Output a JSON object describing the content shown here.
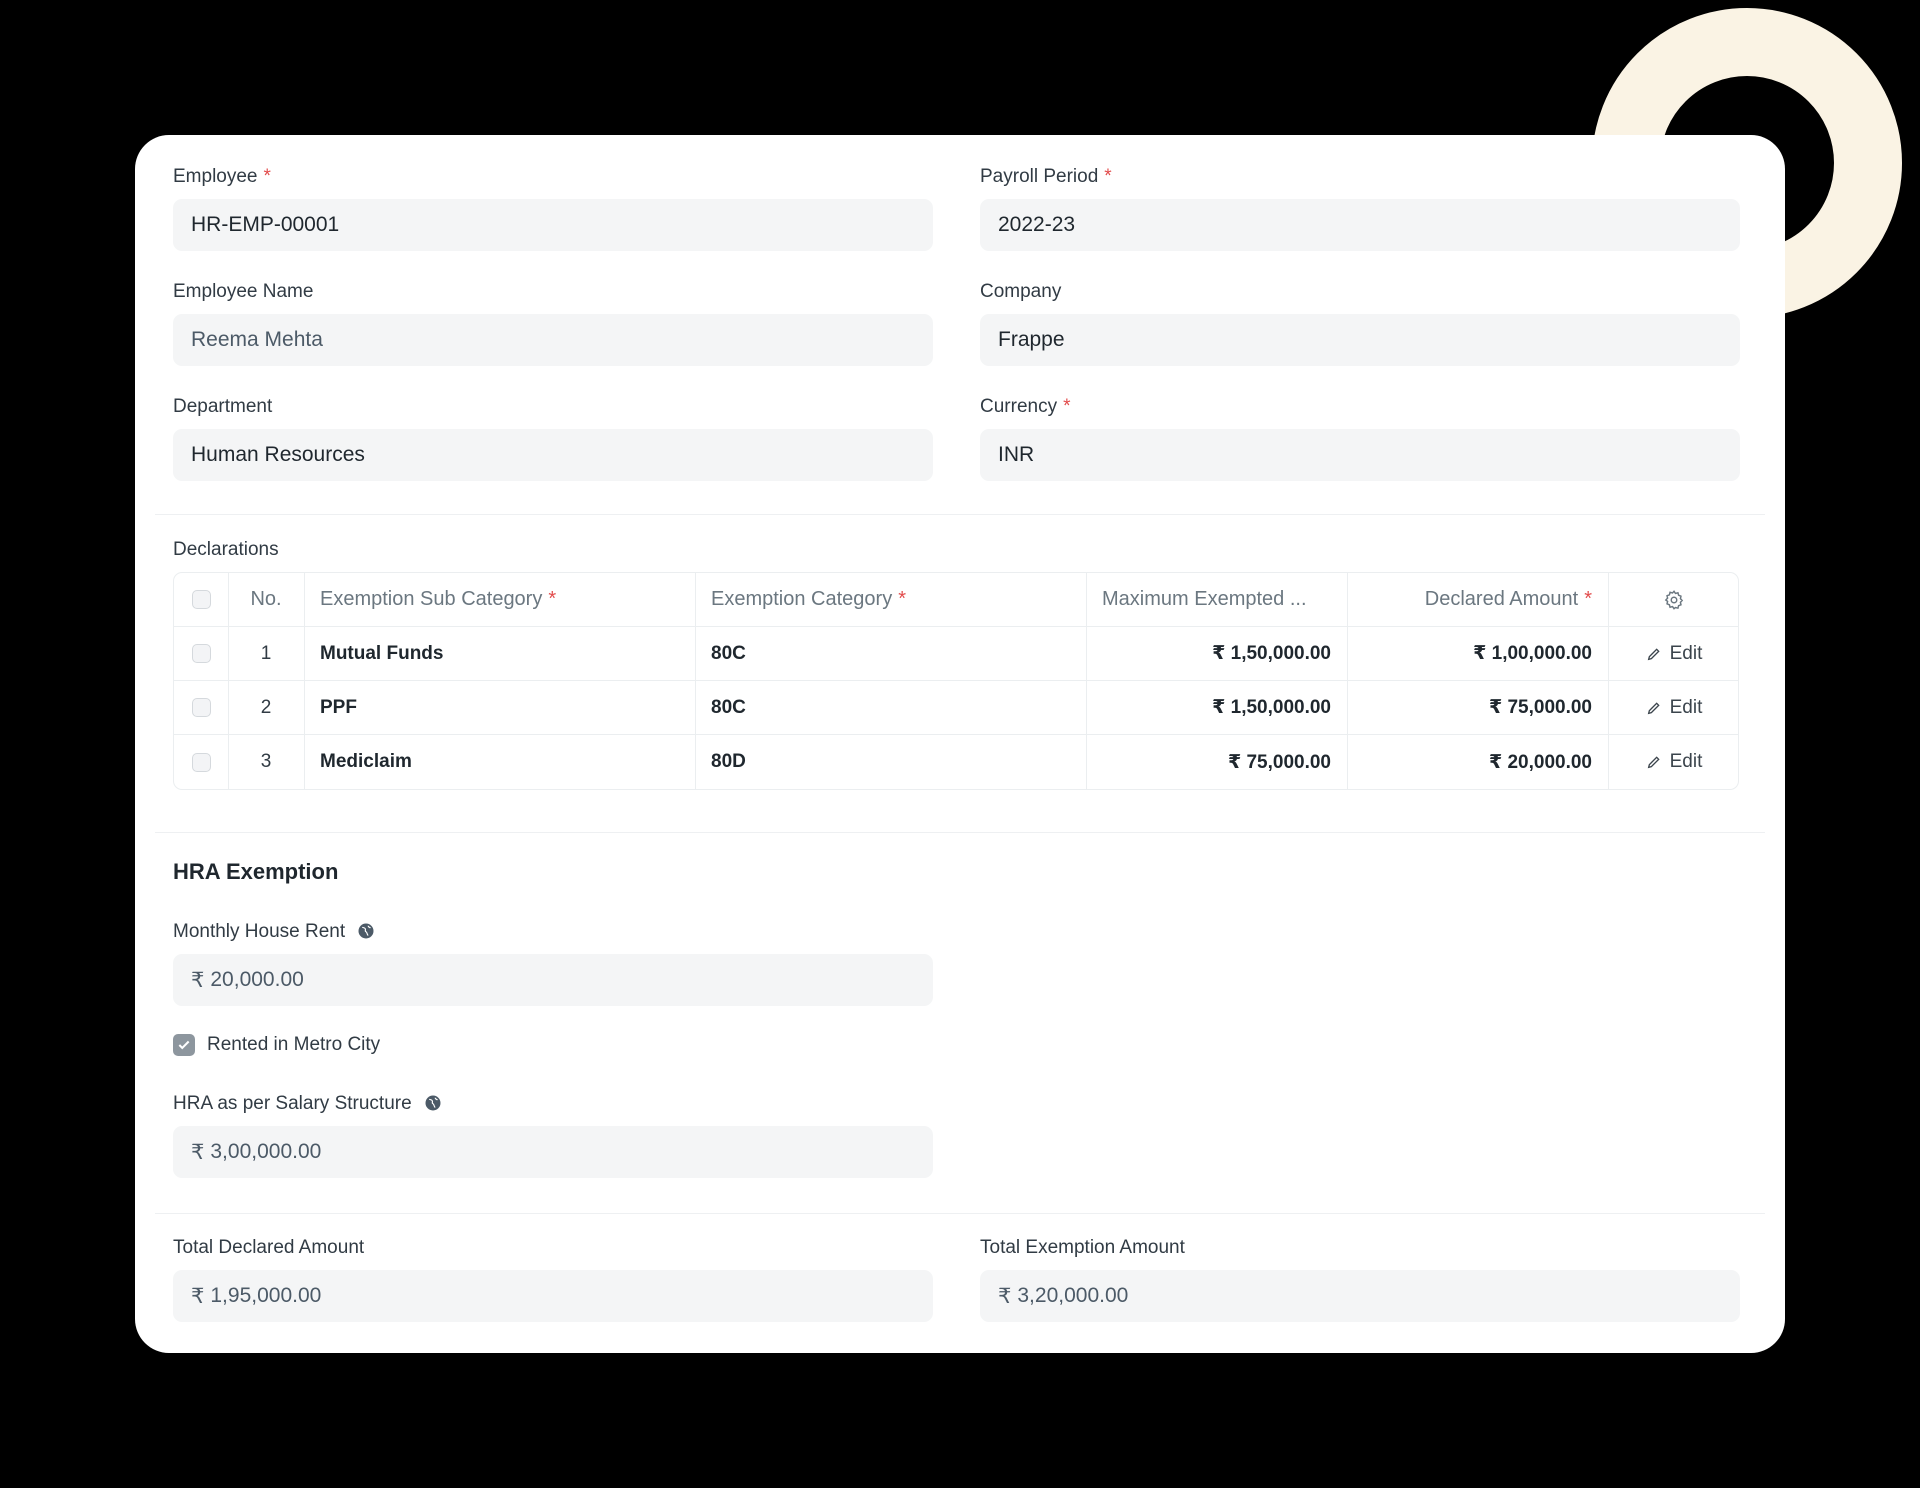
{
  "form": {
    "employee": {
      "label": "Employee",
      "value": "HR-EMP-00001"
    },
    "payroll_period": {
      "label": "Payroll Period",
      "value": "2022-23"
    },
    "employee_name": {
      "label": "Employee Name",
      "value": "Reema Mehta"
    },
    "company": {
      "label": "Company",
      "value": "Frappe"
    },
    "department": {
      "label": "Department",
      "value": "Human Resources"
    },
    "currency": {
      "label": "Currency",
      "value": "INR"
    },
    "required_marker": "*"
  },
  "declarations": {
    "label": "Declarations",
    "columns": {
      "no": "No.",
      "sub_category": "Exemption Sub Category",
      "category": "Exemption Category",
      "max_exempted": "Maximum Exempted ...",
      "declared": "Declared Amount"
    },
    "edit_label": "Edit",
    "rows": [
      {
        "no": "1",
        "sub_category": "Mutual Funds",
        "category": "80C",
        "max_exempted": "₹ 1,50,000.00",
        "declared": "₹ 1,00,000.00"
      },
      {
        "no": "2",
        "sub_category": "PPF",
        "category": "80C",
        "max_exempted": "₹ 1,50,000.00",
        "declared": "₹ 75,000.00"
      },
      {
        "no": "3",
        "sub_category": "Mediclaim",
        "category": "80D",
        "max_exempted": "₹ 75,000.00",
        "declared": "₹ 20,000.00"
      }
    ]
  },
  "hra": {
    "title": "HRA Exemption",
    "monthly_rent": {
      "label": "Monthly House Rent",
      "currency": "₹",
      "value": "20,000.00"
    },
    "metro": {
      "label": "Rented in Metro City",
      "checked": true
    },
    "hra_salary": {
      "label": "HRA as per Salary Structure",
      "currency": "₹",
      "value": "3,00,000.00"
    }
  },
  "totals": {
    "declared": {
      "label": "Total Declared Amount",
      "currency": "₹",
      "value": "1,95,000.00"
    },
    "exemption": {
      "label": "Total Exemption Amount",
      "currency": "₹",
      "value": "3,20,000.00"
    }
  },
  "colors": {
    "background": "#000000",
    "card": "#ffffff",
    "field": "#f4f5f6",
    "required": "#e24c4c",
    "ring": "#faf3e4"
  },
  "icons": {
    "settings": "gear-icon",
    "edit": "pencil-icon",
    "global": "globe-icon",
    "checkbox": "check-icon"
  }
}
